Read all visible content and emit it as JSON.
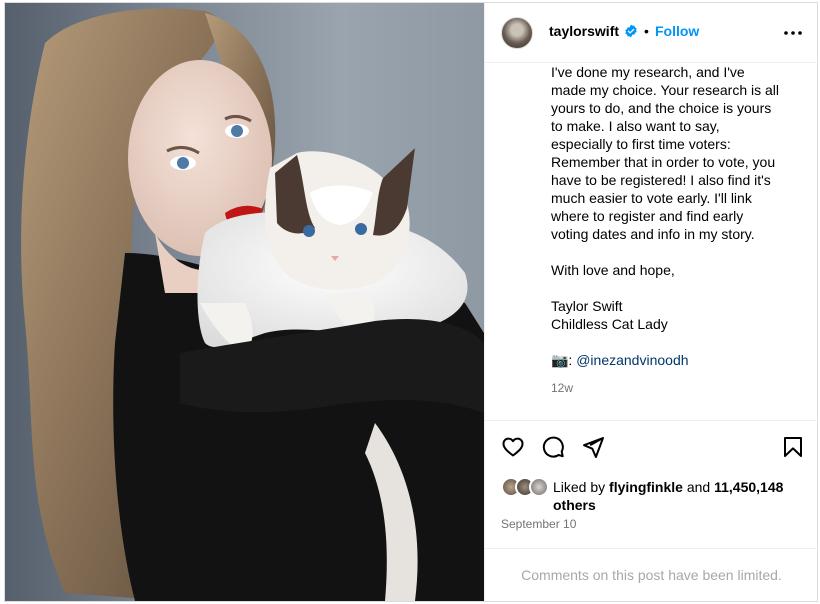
{
  "header": {
    "username": "taylorswift",
    "separator": "•",
    "follow_label": "Follow"
  },
  "caption": {
    "paragraph1": "I've done my research, and I've\nmade my choice. Your research is all\nyours to do, and the choice is yours\nto make. I also want to say,\nespecially to first time voters:\nRemember that in order to vote, you\nhave to be registered! I also find it's\nmuch easier to vote early. I'll link\nwhere to register and find early\nvoting dates and info in my story.",
    "paragraph2": "With love and hope,",
    "signature_name": "Taylor Swift",
    "signature_title": "Childless Cat Lady",
    "credit_emoji": "📷:",
    "credit_handle": "@inezandvinoodh",
    "time_ago": "12w"
  },
  "likes": {
    "prefix": "Liked by",
    "user": "flyingfinkle",
    "middle": "and",
    "count": "11,450,148",
    "suffix": "others"
  },
  "date": "September 10",
  "comments_limited": "Comments on this post have been limited.",
  "icons": {
    "verified": "verified-badge-icon",
    "more": "more-options-icon",
    "like": "heart-icon",
    "comment": "comment-icon",
    "share": "share-icon",
    "save": "bookmark-icon"
  },
  "colors": {
    "follow": "#0095f6",
    "verified": "#0095f6",
    "muted": "#737373",
    "link": "#00376b"
  }
}
